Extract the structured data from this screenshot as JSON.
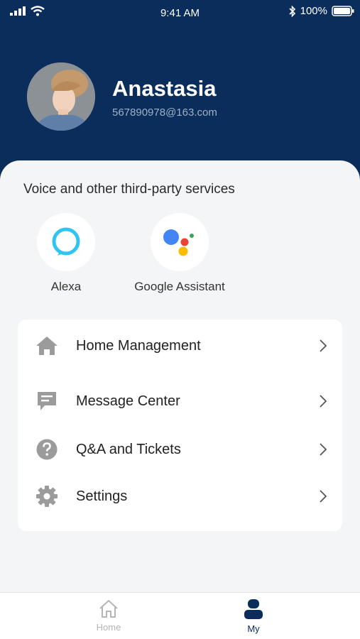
{
  "status_bar": {
    "time": "9:41 AM",
    "battery": "100%"
  },
  "profile": {
    "name": "Anastasia",
    "email": "567890978@163.com"
  },
  "services": {
    "title": "Voice and other third-party services",
    "items": [
      {
        "label": "Alexa",
        "icon": "alexa-icon"
      },
      {
        "label": "Google Assistant",
        "icon": "google-assistant-icon"
      }
    ]
  },
  "menu": {
    "items": [
      {
        "label": "Home Management",
        "icon": "home-icon"
      },
      {
        "label": "Message Center",
        "icon": "message-icon"
      },
      {
        "label": "Q&A and Tickets",
        "icon": "question-icon"
      },
      {
        "label": "Settings",
        "icon": "gear-icon"
      }
    ]
  },
  "tabbar": {
    "tabs": [
      {
        "label": "Home",
        "icon": "home-outline-icon",
        "active": false
      },
      {
        "label": "My",
        "icon": "person-icon",
        "active": true
      }
    ]
  },
  "colors": {
    "header_bg": "#0b2d5b",
    "panel_bg": "#f4f5f7",
    "active_tab": "#0b2d5b",
    "inactive_tab": "#b5b5b5",
    "alexa": "#31c4f3"
  }
}
